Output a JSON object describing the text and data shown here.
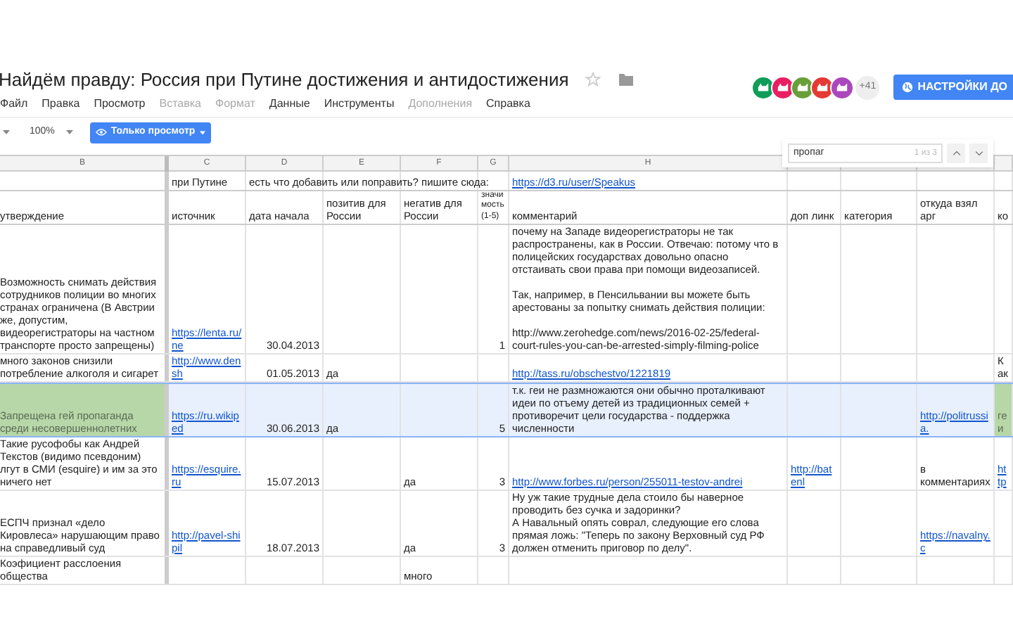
{
  "document": {
    "title": "Найдём правду: Россия при Путине достижения и антидостижения"
  },
  "menu": [
    {
      "label": "Файл",
      "disabled": false
    },
    {
      "label": "Правка",
      "disabled": false
    },
    {
      "label": "Просмотр",
      "disabled": false
    },
    {
      "label": "Вставка",
      "disabled": true
    },
    {
      "label": "Формат",
      "disabled": true
    },
    {
      "label": "Данные",
      "disabled": false
    },
    {
      "label": "Инструменты",
      "disabled": false
    },
    {
      "label": "Дополнения",
      "disabled": true
    },
    {
      "label": "Справка",
      "disabled": false
    }
  ],
  "toolbar": {
    "zoom": "100%",
    "mode_button": "Только просмотр"
  },
  "collaborators": [
    {
      "color": "#0f9d58"
    },
    {
      "color": "#e91e63"
    },
    {
      "color": "#689f38"
    },
    {
      "color": "#e53935"
    },
    {
      "color": "#ab47bc"
    }
  ],
  "collaborators_more": "+41",
  "share_button": "НАСТРОЙКИ ДО",
  "find": {
    "value": "пропаг",
    "count": "1 из 3"
  },
  "columns": [
    "B",
    "C",
    "D",
    "E",
    "F",
    "G",
    "H",
    null,
    null,
    null,
    null
  ],
  "header_rows": [
    {
      "cells": [
        null,
        {
          "text": "при Путине"
        },
        {
          "text": "есть что добавить или поправить? пишите сюда:",
          "overflow": true
        },
        null,
        null,
        null,
        {
          "text": "https://d3.ru/user/Speakus",
          "kind": "link"
        },
        null,
        null,
        null,
        null
      ]
    },
    {
      "cells": [
        {
          "text": "утверждение"
        },
        {
          "text": "источник"
        },
        {
          "text": "дата начала"
        },
        {
          "text": "позитив для России"
        },
        {
          "text": "негатив для России"
        },
        {
          "text": "значимость (1-5)"
        },
        {
          "text": "комментарий"
        },
        {
          "text": "доп линк"
        },
        {
          "text": "категория"
        },
        {
          "text": "откуда взял арг"
        },
        {
          "text": "ко"
        }
      ]
    }
  ],
  "rows": [
    {
      "selected": false,
      "cells": [
        {
          "text": "Возможность снимать действия сотрудников полиции во многих странах ограничена (В Австрии же, допустим, видеорегистраторы на частном транспорте просто запрещены)"
        },
        {
          "text": "https://lenta.ru/ne",
          "kind": "link"
        },
        {
          "text": "30.04.2013",
          "kind": "number"
        },
        null,
        null,
        {
          "text": "1",
          "kind": "number"
        },
        {
          "text": "почему на Западе видеорегистраторы не так распространены, как в России. Отвечаю: потому что в полицейских государствах довольно опасно отстаивать свои права при помощи видеозаписей.\n\nТак, например, в Пенсильвании вы можете быть арестованы за попытку снимать действия полиции:\n\nhttp://www.zerohedge.com/news/2016-02-25/federal-court-rules-you-can-be-arrested-simply-filming-police"
        },
        null,
        null,
        null,
        null
      ]
    },
    {
      "selected": false,
      "cells": [
        {
          "text": "много законов снизили потребление алкоголя и сигарет"
        },
        {
          "text": "http://www.densh",
          "kind": "link"
        },
        {
          "text": "01.05.2013",
          "kind": "number"
        },
        {
          "text": "да"
        },
        null,
        null,
        {
          "text": "http://tass.ru/obschestvo/1221819",
          "kind": "link"
        },
        null,
        null,
        null,
        {
          "text": "Как"
        }
      ]
    },
    {
      "selected": true,
      "cells": [
        {
          "text": "Запрещена гей пропаганда среди несовершеннолетних",
          "highlight": true
        },
        {
          "text": "https://ru.wikiped",
          "kind": "link"
        },
        {
          "text": "30.06.2013",
          "kind": "number"
        },
        {
          "text": "да"
        },
        null,
        {
          "text": "5",
          "kind": "number"
        },
        {
          "text": "т.к. геи не размножаются они обычно проталкивают идеи по отъему детей из традиционных семей + противоречит цели государства - поддержка численности"
        },
        null,
        null,
        {
          "text": "http://politrussia.",
          "kind": "link"
        },
        {
          "text": "геи",
          "highlight": true
        }
      ]
    },
    {
      "selected": false,
      "cells": [
        {
          "text": "Такие русофобы как Андрей Текстов (видимо псевдоним) лгут в СМИ (esquire) и им за это ничего нет"
        },
        {
          "text": "https://esquire.ru",
          "kind": "link"
        },
        {
          "text": "15.07.2013",
          "kind": "number"
        },
        null,
        {
          "text": "да"
        },
        {
          "text": "3",
          "kind": "number"
        },
        {
          "text": "http://www.forbes.ru/person/255011-testov-andrei",
          "kind": "link"
        },
        {
          "text": "http://batenl",
          "kind": "link"
        },
        null,
        {
          "text": "в комментариях"
        },
        {
          "text": "http",
          "kind": "link"
        }
      ]
    },
    {
      "selected": false,
      "cells": [
        {
          "text": "ЕСПЧ признал «дело Кировлеса» нарушающим право на справедливый суд"
        },
        {
          "text": "http://pavel-shipil",
          "kind": "link"
        },
        {
          "text": "18.07.2013",
          "kind": "number"
        },
        null,
        {
          "text": "да"
        },
        {
          "text": "3",
          "kind": "number"
        },
        {
          "text": "Ну уж такие трудные дела стоило бы наверное проводить без сучка и задоринки?\nА Навальный опять соврал, следующие его слова прямая ложь: \"Теперь по закону Верховный суд РФ должен отменить приговор по делу\"."
        },
        null,
        null,
        {
          "text": "https://navalny.c",
          "kind": "link"
        },
        null
      ]
    },
    {
      "selected": false,
      "cells": [
        {
          "text": "Коэфициент расслоения общества"
        },
        null,
        null,
        null,
        {
          "text": "много"
        },
        null,
        null,
        null,
        null,
        null,
        null
      ]
    }
  ]
}
